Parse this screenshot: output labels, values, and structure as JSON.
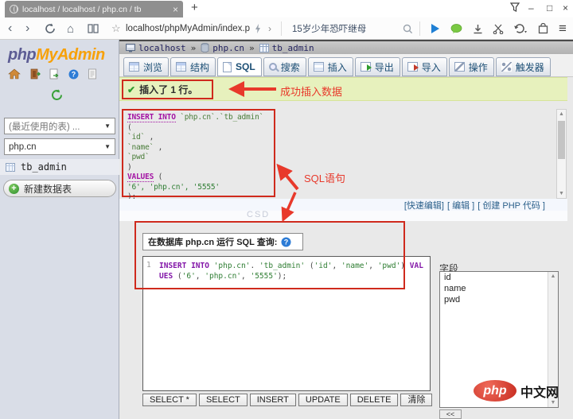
{
  "browser": {
    "tab_title": "localhost / localhost / php.cn / tb",
    "tab_close": "×",
    "new_tab": "+",
    "url": "localhost/phpMyAdmin/index.p",
    "search_text": "15岁少年恐吓继母",
    "window": {
      "minimize": "–",
      "maximize": "□",
      "close": "×"
    },
    "nav": {
      "back": "‹",
      "forward": "›",
      "home": "⌂",
      "star": "☆",
      "url_more": "›",
      "menu": "≡"
    }
  },
  "sidebar": {
    "logo_php": "php",
    "logo_myadmin": "MyAdmin",
    "recent_tables_select": "(最近使用的表) ...",
    "db_select": "php.cn",
    "table_item": "tb_admin",
    "new_table_button": "新建数据表",
    "select_caret": "▼"
  },
  "main": {
    "breadcrumb": {
      "server": "localhost",
      "db": "php.cn",
      "table": "tb_admin",
      "sep": "»"
    },
    "tabs": [
      {
        "label": "浏览"
      },
      {
        "label": "结构"
      },
      {
        "label": "SQL"
      },
      {
        "label": "搜索"
      },
      {
        "label": "插入"
      },
      {
        "label": "导出"
      },
      {
        "label": "导入"
      },
      {
        "label": "操作"
      },
      {
        "label": "触发器"
      }
    ],
    "success_message": "插入了 1 行。",
    "success_check": "✔",
    "annotations": {
      "success": "成功插入数据",
      "sql": "SQL语句"
    },
    "sql_display": {
      "lines": [
        [
          {
            "c": "kw",
            "t": "INSERT INTO"
          },
          {
            "c": "pl",
            "t": " "
          },
          {
            "c": "id",
            "t": "`php.cn`.`tb_admin`"
          },
          {
            "c": "pl",
            "t": " ("
          }
        ],
        [
          {
            "c": "pl",
            "t": " "
          },
          {
            "c": "id",
            "t": "`id`"
          },
          {
            "c": "pl",
            "t": " ,"
          }
        ],
        [
          {
            "c": "pl",
            "t": " "
          },
          {
            "c": "id",
            "t": "`name`"
          },
          {
            "c": "pl",
            "t": " ,"
          }
        ],
        [
          {
            "c": "pl",
            "t": " "
          },
          {
            "c": "id",
            "t": "`pwd`"
          }
        ],
        [
          {
            "c": "pl",
            "t": ")"
          }
        ],
        [
          {
            "c": "kw",
            "t": "VALUES"
          },
          {
            "c": "pl",
            "t": " ("
          }
        ],
        [
          {
            "c": "pl",
            "t": " "
          },
          {
            "c": "st",
            "t": "'6', 'php.cn', '5555'"
          }
        ],
        [
          {
            "c": "pl",
            "t": ");"
          }
        ]
      ]
    },
    "quick_links": [
      "[快速编辑]",
      "[ 编辑 ]",
      "[ 创建 PHP 代码 ]"
    ],
    "watermark": "CSD",
    "query": {
      "legend": "在数据库 php.cn 运行 SQL 查询:",
      "line_number": "1",
      "tokens": [
        {
          "c": "kw",
          "t": "INSERT"
        },
        {
          "c": "pl",
          "t": " "
        },
        {
          "c": "kw",
          "t": "INTO"
        },
        {
          "c": "pl",
          "t": " "
        },
        {
          "c": "st",
          "t": "'php.cn'"
        },
        {
          "c": "pl",
          "t": ". "
        },
        {
          "c": "st",
          "t": "'tb_admin'"
        },
        {
          "c": "pl",
          "t": " ("
        },
        {
          "c": "st",
          "t": "'id'"
        },
        {
          "c": "pl",
          "t": ", "
        },
        {
          "c": "st",
          "t": "'name'"
        },
        {
          "c": "pl",
          "t": ", "
        },
        {
          "c": "st",
          "t": "'pwd'"
        },
        {
          "c": "pl",
          "t": ") "
        },
        {
          "c": "kw",
          "t": "VALUES"
        },
        {
          "c": "pl",
          "t": " ("
        },
        {
          "c": "st",
          "t": "'6'"
        },
        {
          "c": "pl",
          "t": ", "
        },
        {
          "c": "st",
          "t": "'php.cn'"
        },
        {
          "c": "pl",
          "t": ", "
        },
        {
          "c": "st",
          "t": "'5555'"
        },
        {
          "c": "pl",
          "t": ");"
        }
      ],
      "buttons": [
        "SELECT *",
        "SELECT",
        "INSERT",
        "UPDATE",
        "DELETE",
        "清除"
      ]
    },
    "fields_panel": {
      "label": "字段",
      "items": [
        "id",
        "name",
        "pwd"
      ],
      "collapse": "<<"
    }
  },
  "brand": {
    "php": "php",
    "cn": "中文网"
  },
  "colors": {
    "annotation_red": "#e8392b",
    "box_red": "#cf2a1d",
    "success_bg": "#e7f1bd",
    "logo_orange": "#f7a10a",
    "logo_blue": "#5c5c94",
    "link_blue": "#2a5f8a",
    "keyword_purple": "#a312a3",
    "identifier_green": "#2e7d32",
    "brand_red": "#c62a1e"
  }
}
